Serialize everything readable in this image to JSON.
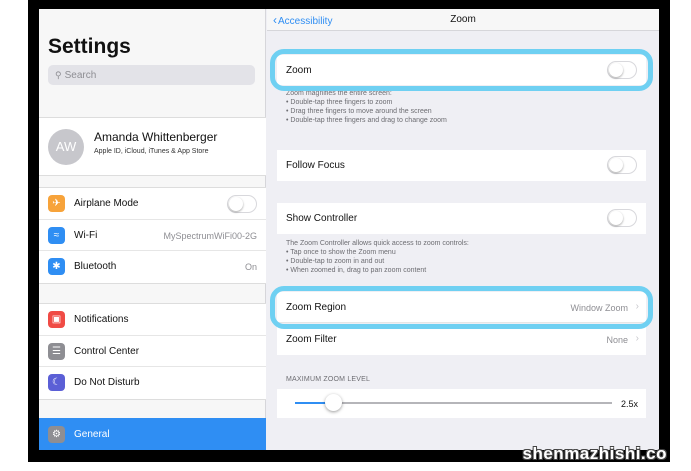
{
  "sidebar": {
    "title": "Settings",
    "search_placeholder": "Search",
    "profile": {
      "initials": "AW",
      "name": "Amanda Whittenberger",
      "subtitle": "Apple ID, iCloud, iTunes & App Store"
    },
    "group1": [
      {
        "label": "Airplane Mode",
        "icon": "airplane-icon",
        "color": "#f7a33a",
        "toggle": false
      },
      {
        "label": "Wi-Fi",
        "icon": "wifi-icon",
        "color": "#2f8ef3",
        "value": "MySpectrumWiFi00-2G"
      },
      {
        "label": "Bluetooth",
        "icon": "bluetooth-icon",
        "color": "#2f8ef3",
        "value": "On"
      }
    ],
    "group2": [
      {
        "label": "Notifications",
        "icon": "notifications-icon",
        "color": "#f04b45"
      },
      {
        "label": "Control Center",
        "icon": "control-center-icon",
        "color": "#8e8e93"
      },
      {
        "label": "Do Not Disturb",
        "icon": "moon-icon",
        "color": "#5b5fd6"
      }
    ],
    "selected": {
      "label": "General",
      "icon": "gear-icon",
      "color": "#2f8ef3"
    }
  },
  "nav": {
    "back_label": "Accessibility",
    "title": "Zoom"
  },
  "zoom": {
    "zoom_label": "Zoom",
    "zoom_on": false,
    "zoom_note": [
      "Zoom magnifies the entire screen:",
      "• Double-tap three fingers to zoom",
      "• Drag three fingers to move around the screen",
      "• Double-tap three fingers and drag to change zoom"
    ],
    "follow_focus_label": "Follow Focus",
    "follow_focus_on": false,
    "show_controller_label": "Show Controller",
    "show_controller_on": false,
    "controller_note": [
      "The Zoom Controller allows quick access to zoom controls:",
      "• Tap once to show the Zoom menu",
      "• Double-tap to zoom in and out",
      "• When zoomed in, drag to pan zoom content"
    ],
    "region_label": "Zoom Region",
    "region_value": "Window Zoom",
    "filter_label": "Zoom Filter",
    "filter_value": "None",
    "max_zoom_header": "MAXIMUM ZOOM LEVEL",
    "max_zoom_value": "2.5x",
    "max_zoom_fraction": 0.12
  },
  "colors": {
    "accent": "#2f8ef3",
    "highlight": "#6fd0f2"
  },
  "watermark": "shenmazhishi.co"
}
